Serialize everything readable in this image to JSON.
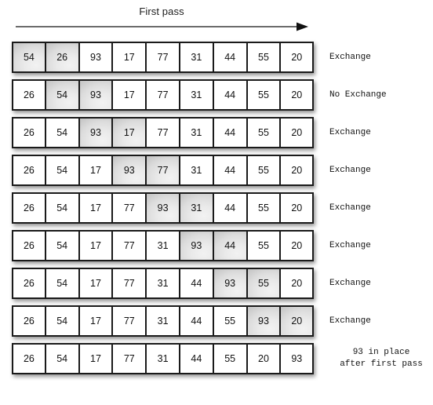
{
  "header": {
    "pass_title": "First pass",
    "arrow_icon": "right-arrow-icon"
  },
  "colors": {
    "background": "#ffffff",
    "cell_border": "#1a1a1a",
    "cell_fill": "#ffffff",
    "cell_highlight_fill": "#dcdcdc",
    "text": "#111111"
  },
  "chart_data": {
    "type": "table",
    "title": "First pass",
    "xlabel": "",
    "ylabel": "",
    "categories": [
      "0",
      "1",
      "2",
      "3",
      "4",
      "5",
      "6",
      "7",
      "8"
    ],
    "rows": [
      {
        "values": [
          54,
          26,
          93,
          17,
          77,
          31,
          44,
          55,
          20
        ],
        "highlighted": [
          0,
          1
        ],
        "label": "Exchange",
        "label_lines": [
          "Exchange"
        ],
        "label_align": "left"
      },
      {
        "values": [
          26,
          54,
          93,
          17,
          77,
          31,
          44,
          55,
          20
        ],
        "highlighted": [
          1,
          2
        ],
        "label": "No Exchange",
        "label_lines": [
          "No Exchange"
        ],
        "label_align": "left"
      },
      {
        "values": [
          26,
          54,
          93,
          17,
          77,
          31,
          44,
          55,
          20
        ],
        "highlighted": [
          2,
          3
        ],
        "label": "Exchange",
        "label_lines": [
          "Exchange"
        ],
        "label_align": "left"
      },
      {
        "values": [
          26,
          54,
          17,
          93,
          77,
          31,
          44,
          55,
          20
        ],
        "highlighted": [
          3,
          4
        ],
        "label": "Exchange",
        "label_lines": [
          "Exchange"
        ],
        "label_align": "left"
      },
      {
        "values": [
          26,
          54,
          17,
          77,
          93,
          31,
          44,
          55,
          20
        ],
        "highlighted": [
          4,
          5
        ],
        "label": "Exchange",
        "label_lines": [
          "Exchange"
        ],
        "label_align": "left"
      },
      {
        "values": [
          26,
          54,
          17,
          77,
          31,
          93,
          44,
          55,
          20
        ],
        "highlighted": [
          5,
          6
        ],
        "label": "Exchange",
        "label_lines": [
          "Exchange"
        ],
        "label_align": "left"
      },
      {
        "values": [
          26,
          54,
          17,
          77,
          31,
          44,
          93,
          55,
          20
        ],
        "highlighted": [
          6,
          7
        ],
        "label": "Exchange",
        "label_lines": [
          "Exchange"
        ],
        "label_align": "left"
      },
      {
        "values": [
          26,
          54,
          17,
          77,
          31,
          44,
          55,
          93,
          20
        ],
        "highlighted": [
          7,
          8
        ],
        "label": "Exchange",
        "label_lines": [
          "Exchange"
        ],
        "label_align": "left"
      },
      {
        "values": [
          26,
          54,
          17,
          77,
          31,
          44,
          55,
          20,
          93
        ],
        "highlighted": [],
        "label": "93 in place after first pass",
        "label_lines": [
          "93 in place",
          "after first pass"
        ],
        "label_align": "center"
      }
    ]
  }
}
